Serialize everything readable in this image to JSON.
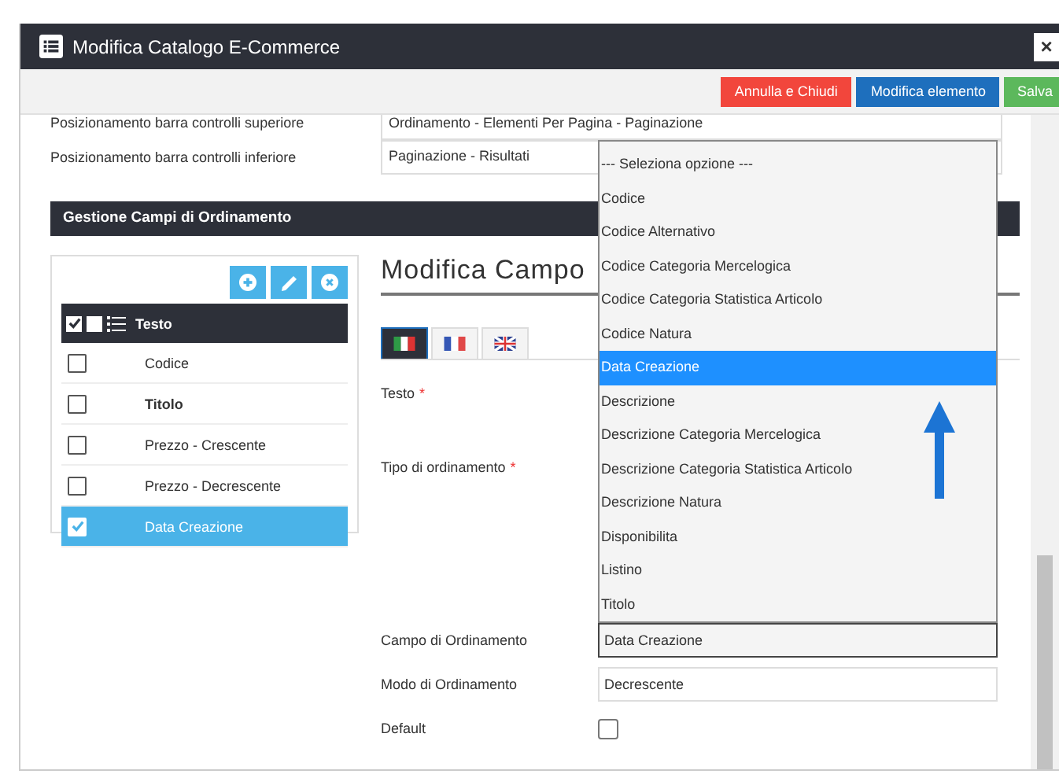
{
  "window": {
    "title": "Modifica Catalogo E-Commerce",
    "close": "×"
  },
  "toolbar": {
    "buttons": [
      {
        "label": "Annulla e Chiudi",
        "kind": "danger"
      },
      {
        "label": "Modifica elemento",
        "kind": "primary"
      },
      {
        "label": "Salva",
        "kind": "success"
      }
    ]
  },
  "settings": [
    {
      "label": "Posizionamento barra controlli superiore",
      "value": "Ordinamento - Elementi Per Pagina - Paginazione"
    },
    {
      "label": "Posizionamento barra controlli inferiore",
      "value": "Paginazione - Risultati"
    }
  ],
  "section": {
    "title": "Gestione Campi di Ordinamento"
  },
  "list": {
    "header": "Testo",
    "header_boxes": [
      {
        "checked": true
      },
      {
        "checked": false
      }
    ],
    "rows": [
      {
        "label": "Codice",
        "checked": false,
        "selected": false,
        "bold": false
      },
      {
        "label": "Titolo",
        "checked": false,
        "selected": false,
        "bold": true
      },
      {
        "label": "Prezzo - Crescente",
        "checked": false,
        "selected": false,
        "bold": false
      },
      {
        "label": "Prezzo - Decrescente",
        "checked": false,
        "selected": false,
        "bold": false
      },
      {
        "label": "Data Creazione",
        "checked": true,
        "selected": true,
        "bold": false
      }
    ]
  },
  "editor": {
    "title": "Modifica Campo",
    "required_mark": "*",
    "language_tabs": [
      {
        "kind": "it",
        "selected": true
      },
      {
        "kind": "fr",
        "selected": false
      },
      {
        "kind": "gb",
        "selected": false
      }
    ],
    "fields": [
      {
        "label": "Testo",
        "required": true,
        "kind": "hidden"
      },
      {
        "label": "Tipo di ordinamento",
        "required": true,
        "kind": "hidden"
      },
      {
        "label": "Campo di Ordinamento",
        "required": false,
        "kind": "select",
        "value": "Data Creazione"
      },
      {
        "label": "Modo di Ordinamento",
        "required": false,
        "kind": "text",
        "value": "Decrescente"
      },
      {
        "label": "Default",
        "required": false,
        "kind": "checkbox",
        "checked": false
      }
    ],
    "dropdown_options": [
      {
        "label": "--- Seleziona opzione ---",
        "selected": false
      },
      {
        "label": "Codice",
        "selected": false
      },
      {
        "label": "Codice Alternativo",
        "selected": false
      },
      {
        "label": "Codice Categoria Mercelogica",
        "selected": false
      },
      {
        "label": "Codice Categoria Statistica Articolo",
        "selected": false
      },
      {
        "label": "Codice Natura",
        "selected": false
      },
      {
        "label": "Data Creazione",
        "selected": true
      },
      {
        "label": "Descrizione",
        "selected": false
      },
      {
        "label": "Descrizione Categoria Mercelogica",
        "selected": false
      },
      {
        "label": "Descrizione Categoria Statistica Articolo",
        "selected": false
      },
      {
        "label": "Descrizione Natura",
        "selected": false
      },
      {
        "label": "Disponibilita",
        "selected": false
      },
      {
        "label": "Listino",
        "selected": false
      },
      {
        "label": "Titolo",
        "selected": false
      }
    ]
  }
}
